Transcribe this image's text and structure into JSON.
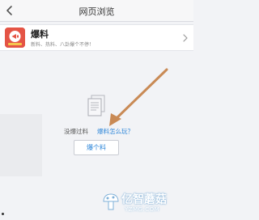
{
  "header": {
    "title": "网页浏览",
    "back_icon": "chevron-left-icon"
  },
  "card": {
    "title": "爆料",
    "subtitle": "新料、热料、八卦爆个不停！",
    "logo_icon": "megaphone-logo-icon",
    "arrow_icon": "chevron-right-icon"
  },
  "empty_state": {
    "icon": "document-icon",
    "message": "没爆过料",
    "help_link": "爆料怎么玩？",
    "button_label": "爆个料"
  },
  "watermark": {
    "main": "亿智蘑菇",
    "sub": "YZMG.COM"
  },
  "colors": {
    "page_bg": "#f2f3f6",
    "link_blue": "#2d86d9",
    "logo_red": "#e45445",
    "arrow_annotation": "#c98a55"
  }
}
